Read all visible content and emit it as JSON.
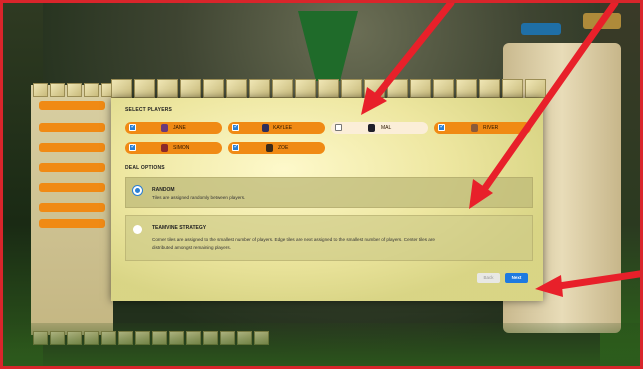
{
  "sections": {
    "select_players": "SELECT PLAYERS",
    "deal_options": "DEAL OPTIONS"
  },
  "players": [
    {
      "name": "JANE",
      "checked": true,
      "avatar_color": "#6a3a7a"
    },
    {
      "name": "KAYLEE",
      "checked": true,
      "avatar_color": "#2f2f5a"
    },
    {
      "name": "MAL",
      "checked": false,
      "avatar_color": "#1f1f2a"
    },
    {
      "name": "RIVER",
      "checked": true,
      "avatar_color": "#8a5a3a"
    },
    {
      "name": "SIMON",
      "checked": true,
      "avatar_color": "#8a2a2a"
    },
    {
      "name": "ZOE",
      "checked": true,
      "avatar_color": "#3a2a1a"
    }
  ],
  "deal_options": [
    {
      "title": "RANDOM",
      "description": "Tiles are assigned randomly between players.",
      "selected": true
    },
    {
      "title": "TEAMVINE STRATEGY",
      "description_line1": "Corner tiles are assigned to the smallest number of players. Edge tiles are next assigned to the smallest number of players. Center tiles are",
      "description_line2": "distributed amongst remaining players.",
      "selected": false
    }
  ],
  "buttons": {
    "back": "Back",
    "next": "Next"
  },
  "background": {
    "top_button_a": "",
    "top_button_b": ""
  },
  "colors": {
    "chip_orange": "#f08a14",
    "checkbox_blue": "#2a7fd4",
    "next_blue": "#1e7ae0",
    "annotation_red": "#e8202a"
  }
}
